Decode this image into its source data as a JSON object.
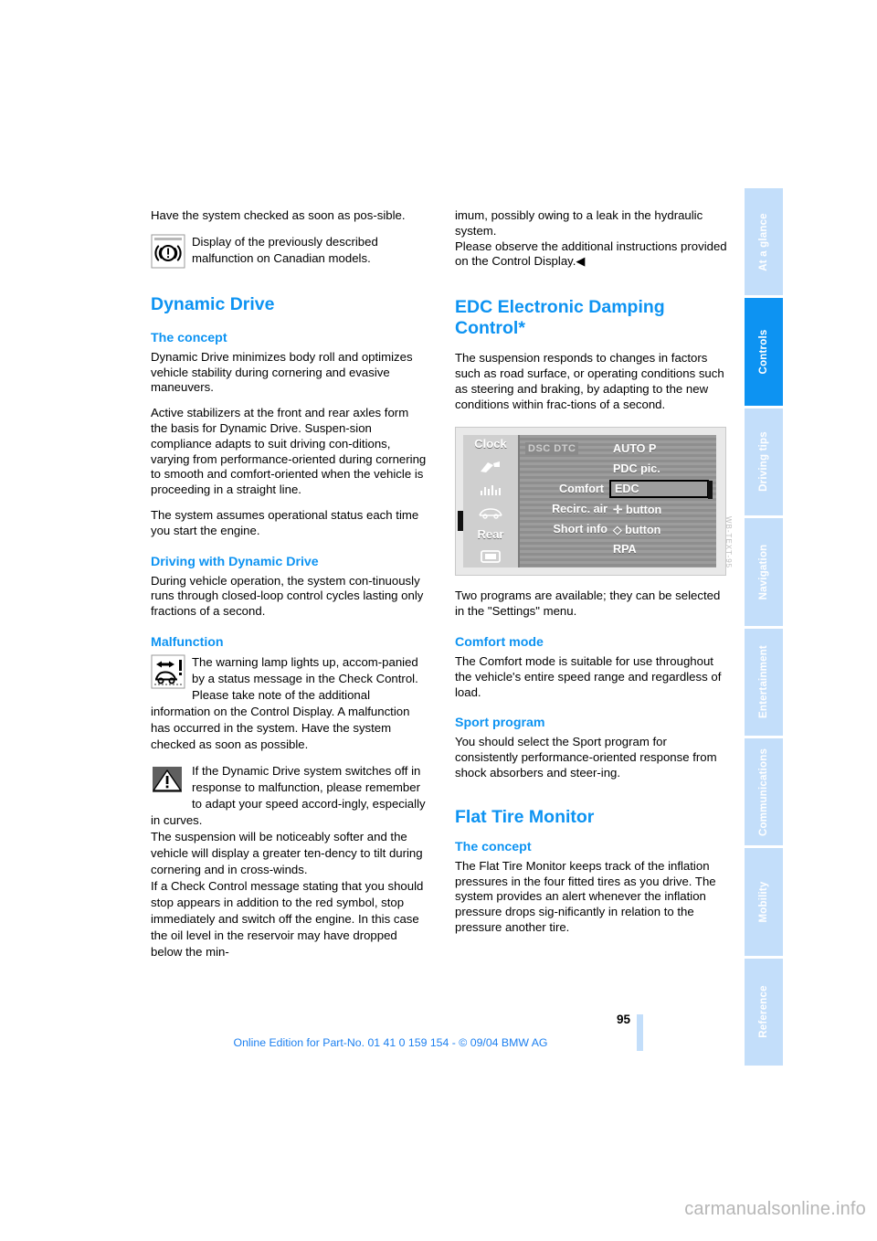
{
  "document": {
    "page_number": "95",
    "footer_note": "Online Edition for Part-No. 01 41 0 159 154 - © 09/04 BMW AG",
    "watermark": "carmanualsonline.info",
    "figure_code": "WB-TEXT-95"
  },
  "sidebar": {
    "tabs": [
      {
        "label": "At a glance",
        "active": false
      },
      {
        "label": "Controls",
        "active": true
      },
      {
        "label": "Driving tips",
        "active": false
      },
      {
        "label": "Navigation",
        "active": false
      },
      {
        "label": "Entertainment",
        "active": false
      },
      {
        "label": "Communications",
        "active": false
      },
      {
        "label": "Mobility",
        "active": false
      },
      {
        "label": "Reference",
        "active": false
      }
    ]
  },
  "left_column": {
    "intro_text": "Have the system checked as soon as pos-sible.",
    "brake_note": "Display of the previously described malfunction on Canadian models.",
    "dynamic_drive_heading": "Dynamic Drive",
    "concept_heading": "The concept",
    "concept_p1": "Dynamic Drive minimizes body roll and optimizes vehicle stability during cornering and evasive maneuvers.",
    "concept_p2": "Active stabilizers at the front and rear axles form the basis for Dynamic Drive. Suspen-sion compliance adapts to suit driving con-ditions, varying from performance-oriented during cornering to smooth and comfort-oriented when the vehicle is proceeding in a straight line.",
    "concept_p3": "The system assumes operational status each time you start the engine.",
    "driving_heading": "Driving with Dynamic Drive",
    "driving_p1": "During vehicle operation, the system con-tinuously runs through closed-loop control cycles lasting only fractions of a second.",
    "malfunction_heading": "Malfunction",
    "malfunction_note": "The warning lamp lights up, accom-panied by a status message in the Check Control. Please take note of the additional information on the Control Display. A malfunction has occurred in the system. Have the system checked as soon as possible.",
    "warning_note": "If the Dynamic Drive system switches off in response to malfunction, please remember to adapt your speed accord-ingly, especially in curves.\nThe suspension will be noticeably softer and the vehicle will display a greater ten-dency to tilt during cornering and in cross-winds.\nIf a Check Control message stating that you should stop appears in addition to the red symbol, stop immediately and switch off the engine. In this case the oil level in the reservoir may have dropped below the min-"
  },
  "right_column": {
    "continuation_text": "imum, possibly owing to a leak in the hydraulic system.\nPlease observe the additional instructions provided on the Control Display.◀",
    "edc_heading": "EDC Electronic Damping Control*",
    "edc_p1": "The suspension responds to changes in factors such as road surface, or operating conditions such as steering and braking, by adapting to the new conditions within frac-tions of a second.",
    "edc_p2": "Two programs are available; they can be selected in the \"Settings\" menu.",
    "comfort_heading": "Comfort mode",
    "comfort_p1": "The Comfort mode is suitable for use throughout the vehicle's entire speed range and regardless of load.",
    "sport_heading": "Sport program",
    "sport_p1": "You should select the Sport program for consistently performance-oriented response from shock absorbers and steer-ing.",
    "flat_tire_heading": "Flat Tire Monitor",
    "flat_tire_concept_heading": "The concept",
    "flat_tire_p1": "The Flat Tire Monitor keeps track of the inflation pressures in the four fitted tires as you drive. The system provides an alert whenever the inflation pressure drops sig-nificantly in relation to the pressure another tire."
  },
  "control_display": {
    "left_menu": {
      "clock_label": "Clock",
      "rear_label": "Rear"
    },
    "rows": [
      {
        "tag": "DSC  DTC",
        "mid": "",
        "right": "AUTO  P",
        "selected": false
      },
      {
        "tag": "",
        "mid": "",
        "right": "PDC pic.",
        "selected": false
      },
      {
        "tag": "",
        "mid": "Comfort",
        "right": "EDC",
        "selected": true
      },
      {
        "tag": "",
        "mid": "Recirc. air",
        "right": "✛ button",
        "selected": false
      },
      {
        "tag": "",
        "mid": "Short info",
        "right": "◇ button",
        "selected": false
      },
      {
        "tag": "",
        "mid": "",
        "right": "RPA",
        "selected": false
      }
    ]
  },
  "colors": {
    "heading_blue": "#0d93f2",
    "tab_inactive": "#c3defa",
    "tab_active": "#0d93f2",
    "footer_blue": "#1b7ff0"
  }
}
